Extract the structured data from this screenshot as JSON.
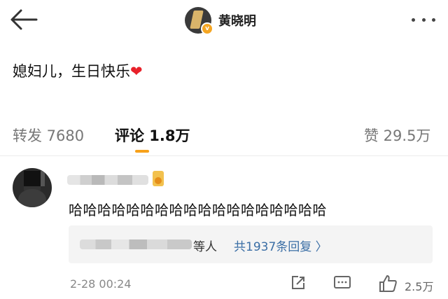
{
  "header": {
    "user_name": "黄晓明",
    "verified_mark": "v"
  },
  "post": {
    "text": "媳妇儿，生日快乐",
    "heart": "❤"
  },
  "tabs": {
    "repost": "转发 7680",
    "comments": "评论 1.8万",
    "likes": "赞 29.5万"
  },
  "comment": {
    "text": "哈哈哈哈哈哈哈哈哈哈哈哈哈哈哈哈哈哈",
    "reply_suffix": "等人",
    "reply_count": "共1937条回复 〉",
    "time": "2-28 00:24",
    "like_count": "2.5万"
  },
  "colors": {
    "accent": "#f7a11a",
    "link": "#3a6ea5",
    "heart": "#e8212a"
  },
  "icons": [
    "back-arrow-icon",
    "more-dots-icon",
    "share-icon",
    "comment-icon",
    "thumbs-up-icon"
  ]
}
